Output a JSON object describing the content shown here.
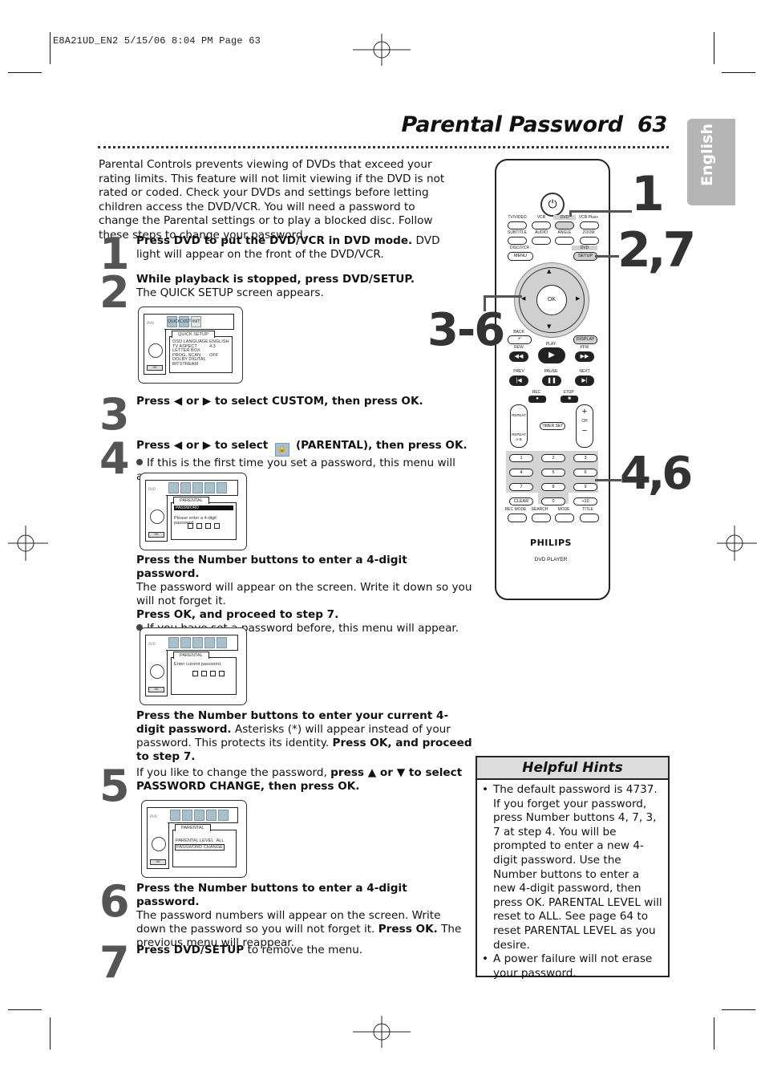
{
  "slug": "E8A21UD_EN2  5/15/06  8:04 PM  Page 63",
  "header": {
    "title": "Parental Password",
    "page_number": "63",
    "language_tab": "English"
  },
  "intro": "Parental Controls prevents viewing of DVDs that exceed your rating limits. This feature will not limit viewing if the DVD is not rated or coded. Check your DVDs and settings before letting children access the DVD/VCR. You will need a password to change the Parental settings or to play a blocked disc. Follow these steps to change your password.",
  "steps": [
    {
      "num": "1",
      "bold": "Press DVD to put the DVD/VCR in DVD mode.",
      "text": " DVD light will appear on the front of the DVD/VCR."
    },
    {
      "num": "2",
      "bold": "While playback is stopped, press DVD/SETUP.",
      "text": "The QUICK SETUP screen appears."
    },
    {
      "num": "3",
      "bold": "Press ◀ or ▶ to select CUSTOM, then press OK."
    },
    {
      "num": "4",
      "bold_a": "Press ◀ or ▶ to select",
      "bold_b": "(PARENTAL), then press OK.",
      "bullet": "If this is the first time you set a password, this menu will appear.",
      "sub1_bold": "Press the Number buttons to enter a 4-digit password.",
      "sub1_text": "The password will appear on the screen. Write it down so you will not forget it.",
      "sub2_bold": "Press OK, and proceed to step 7.",
      "bullet2": "If you have set a password before, this menu will appear.",
      "sub3_bold": "Press the Number buttons to enter your current 4-digit password.",
      "sub3_text": " Asterisks (*) will appear instead of your password. This protects its identity. ",
      "sub3_bold2": "Press OK, and proceed to step 7."
    },
    {
      "num": "5",
      "text": "If you like to change the password, ",
      "bold": "press ▲ or ▼ to select PASSWORD CHANGE, then press OK."
    },
    {
      "num": "6",
      "bold": "Press the Number buttons to enter a 4-digit password.",
      "text": "The password numbers will appear on the screen. Write down the password so you will not forget it. ",
      "bold2": "Press OK.",
      "text2": " The previous menu will reappear."
    },
    {
      "num": "7",
      "bold": "Press DVD/SETUP",
      "text": " to remove the menu."
    }
  ],
  "screens": {
    "quick_setup": {
      "tab": "QUICK SETUP",
      "icons": [
        "QUICK",
        "CUSTOM",
        "INIT"
      ],
      "rows": [
        [
          "OSD LANGUAGE",
          "ENGLISH"
        ],
        [
          "TV ASPECT",
          "4:3 LETTER BOX"
        ],
        [
          "PROG. SCAN",
          "OFF"
        ],
        [
          "DOLBY DIGITAL",
          "BITSTREAM"
        ]
      ]
    },
    "password_new": {
      "tab": "PARENTAL",
      "header": "PASSWORD",
      "prompt": "Please enter a 4-digit password."
    },
    "password_current": {
      "tab": "PARENTAL",
      "prompt": "Enter current password."
    },
    "parental_menu": {
      "tab": "PARENTAL",
      "level_label": "PARENTAL LEVEL",
      "level_value": "ALL",
      "selected": "PASSWORD CHANGE"
    },
    "ok_label": "OK"
  },
  "remote": {
    "row1": [
      "TV/VIDEO",
      "VCR",
      "DVD",
      "VCR Plus+"
    ],
    "row2": [
      "SUBTITLE",
      "AUDIO",
      "ANGLE",
      "ZOOM"
    ],
    "disc_vcr": "DISC/VCR",
    "menu": "MENU",
    "dvd": "DVD",
    "setup": "SETUP",
    "ok": "OK",
    "back": "BACK",
    "display": "DISPLAY",
    "rew": "REW",
    "play": "PLAY",
    "ffw": "FFW",
    "prev": "PREV",
    "pause": "PAUSE",
    "next": "NEXT",
    "rec": "REC",
    "stop": "STOP",
    "repeat": "REPEAT",
    "repeat_ab": "REPEAT A-B",
    "timer_set": "TIMER SET",
    "ch": "CH",
    "numbers": [
      "1",
      "2",
      "3",
      "4",
      "5",
      "6",
      "7",
      "8",
      "9"
    ],
    "clear": "CLEAR",
    "zero": "0",
    "plus10": "+10",
    "bottom": [
      "REC MODE",
      "SEARCH",
      "MODE",
      "TITLE"
    ],
    "brand": "PHILIPS",
    "model": "DVD PLAYER"
  },
  "callouts": [
    "1",
    "2,7",
    "3-6",
    "4,6"
  ],
  "hints": {
    "title": "Helpful Hints",
    "items": [
      "The default password is 4737. If you forget your password, press Number buttons 4, 7, 3, 7 at step 4. You will be prompted to enter a new 4-digit password. Use the Number buttons to enter a new 4-digit password, then press OK. PARENTAL LEVEL will reset to ALL. See page 64 to reset PARENTAL LEVEL as you desire.",
      "A power failure will not erase your password."
    ]
  }
}
